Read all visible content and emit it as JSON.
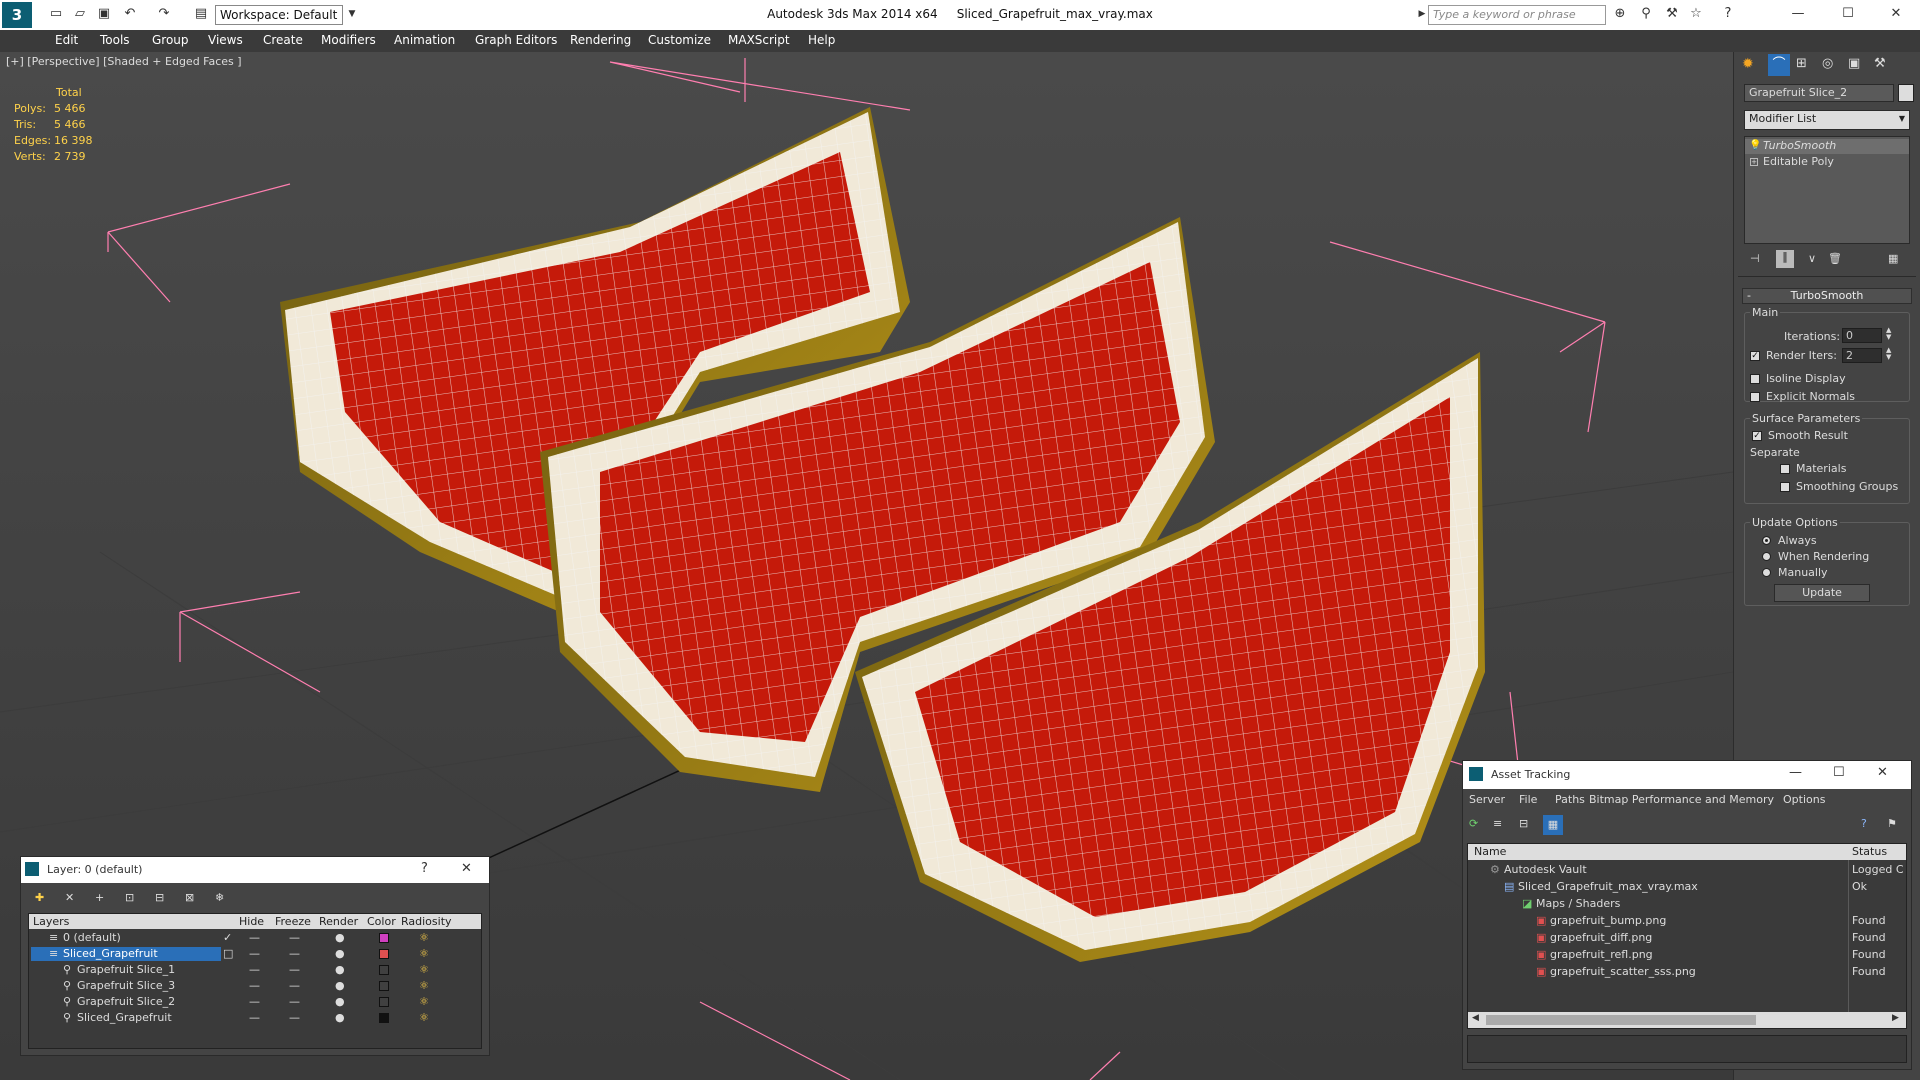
{
  "app": {
    "title": "Autodesk 3ds Max 2014 x64",
    "file": "Sliced_Grapefruit_max_vray.max",
    "workspace": "Workspace: Default",
    "search_placeholder": "Type a keyword or phrase"
  },
  "menus": [
    "Edit",
    "Tools",
    "Group",
    "Views",
    "Create",
    "Modifiers",
    "Animation",
    "Graph Editors",
    "Rendering",
    "Customize",
    "MAXScript",
    "Help"
  ],
  "viewport": {
    "label": "[+] [Perspective] [Shaded + Edged Faces ]",
    "stats": {
      "header": "Total",
      "polys_label": "Polys:",
      "polys": "5 466",
      "tris_label": "Tris:",
      "tris": "5 466",
      "edges_label": "Edges:",
      "edges": "16 398",
      "verts_label": "Verts:",
      "verts": "2 739"
    }
  },
  "command_panel": {
    "object_name": "Grapefruit Slice_2",
    "modifier_list": "Modifier List",
    "stack": [
      "TurboSmooth",
      "Editable Poly"
    ],
    "turbosmooth": {
      "title": "TurboSmooth",
      "main": "Main",
      "iterations_label": "Iterations:",
      "iterations": "0",
      "render_iters_label": "Render Iters:",
      "render_iters": "2",
      "isoline": "Isoline Display",
      "explicit": "Explicit Normals",
      "surface": "Surface Parameters",
      "smooth_result": "Smooth Result",
      "separate": "Separate",
      "materials": "Materials",
      "smoothing_groups": "Smoothing Groups",
      "update_options": "Update Options",
      "always": "Always",
      "when_rendering": "When Rendering",
      "manually": "Manually",
      "update_button": "Update"
    }
  },
  "layer_dialog": {
    "title": "Layer: 0 (default)",
    "help": "?",
    "columns": [
      "Layers",
      "Hide",
      "Freeze",
      "Render",
      "Color",
      "Radiosity"
    ],
    "rows": [
      {
        "name": "0 (default)",
        "color": "#d040c0"
      },
      {
        "name": "Sliced_Grapefruit",
        "color": "#e05050"
      },
      {
        "name": "Grapefruit Slice_1",
        "color": "#404040"
      },
      {
        "name": "Grapefruit Slice_3",
        "color": "#404040"
      },
      {
        "name": "Grapefruit Slice_2",
        "color": "#404040"
      },
      {
        "name": "Sliced_Grapefruit",
        "color": "#111111"
      }
    ]
  },
  "asset_tracking": {
    "title": "Asset Tracking",
    "menus": [
      "Server",
      "File",
      "Paths",
      "Bitmap Performance and Memory",
      "Options"
    ],
    "columns": [
      "Name",
      "Status"
    ],
    "rows": [
      {
        "name": "Autodesk Vault",
        "status": "Logged C"
      },
      {
        "name": "Sliced_Grapefruit_max_vray.max",
        "status": "Ok"
      },
      {
        "name": "Maps / Shaders",
        "status": ""
      },
      {
        "name": "grapefruit_bump.png",
        "status": "Found"
      },
      {
        "name": "grapefruit_diff.png",
        "status": "Found"
      },
      {
        "name": "grapefruit_refl.png",
        "status": "Found"
      },
      {
        "name": "grapefruit_scatter_sss.png",
        "status": "Found"
      }
    ]
  },
  "colors": {
    "accent": "#1e6fd8",
    "stats": "#ffd24a",
    "selection": "#ff7fb0",
    "pulp": "#c51a0a"
  }
}
